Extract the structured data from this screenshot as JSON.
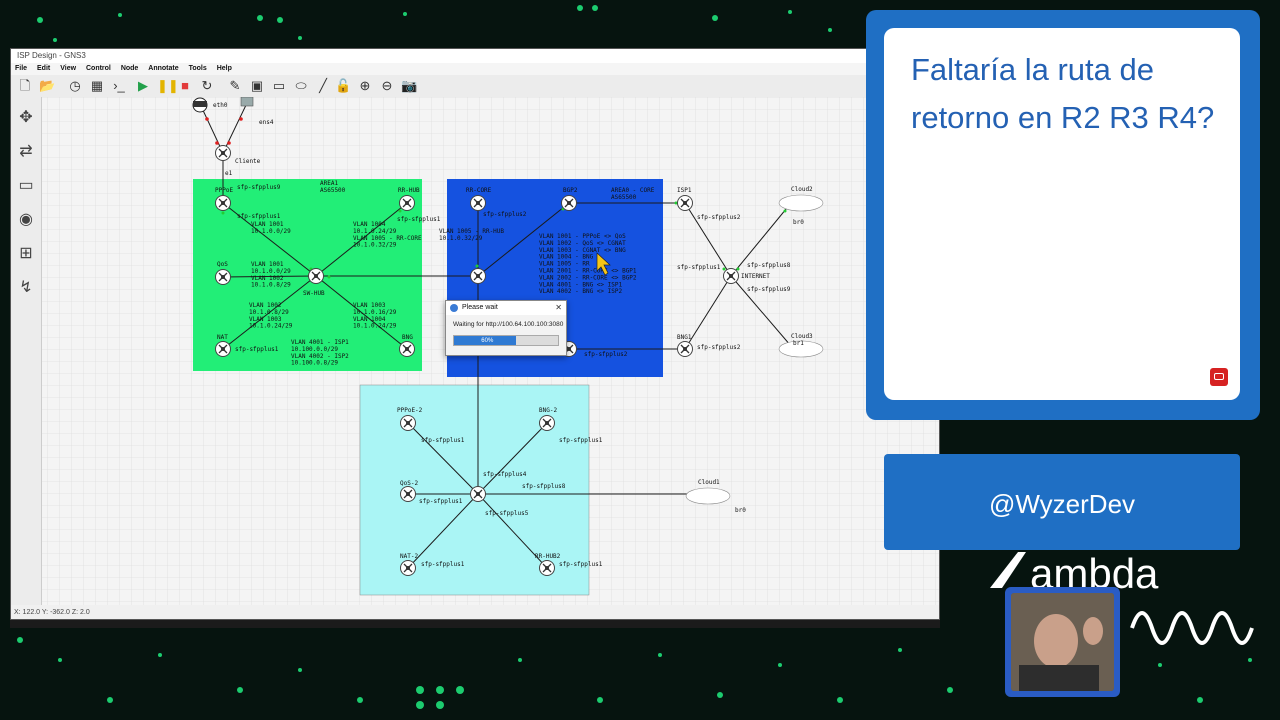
{
  "window": {
    "title": "ISP Design - GNS3",
    "menu": [
      "File",
      "Edit",
      "View",
      "Control",
      "Node",
      "Annotate",
      "Tools",
      "Help"
    ],
    "status": "X: 122.0 Y: -362.0 Z: 2.0"
  },
  "topology": {
    "area_green_label": "AREA1\nAS65500",
    "area_blue_label": "AREA0 - CORE\nAS65500",
    "nodes": {
      "eth0": "eth0",
      "ens4": "ens4",
      "cliente": "Cliente",
      "pppoe": "PPPoE",
      "rr_hub": "RR-HUB",
      "qos": "QoS",
      "sw_hub": "SW-HUB",
      "nat": "NAT",
      "bng": "BNG",
      "rr_core": "RR-CORE",
      "bgp2": "BGP2",
      "isp1": "ISP1",
      "internet": "INTERNET",
      "bng1": "BNG1",
      "cloud2": "Cloud2",
      "cloud3": "Cloud3",
      "cloud1": "Cloud1",
      "br0a": "br0",
      "br0b": "br0",
      "br1": "br1",
      "pppoe2": "PPPoE-2",
      "bng2": "BNG-2",
      "qos2": "QoS-2",
      "nat2": "NAT-2",
      "rrhub2": "RR-HUB2"
    },
    "vlan_green": [
      "VLAN 1001\n10.1.0.0/29",
      "VLAN 1004\n10.1.0.24/29\nVLAN 1005 - RR-CORE\n10.1.0.32/29",
      "VLAN 1001\n10.1.0.0/29\nVLAN 1002\n10.1.0.8/29",
      "VLAN 1002\n10.1.0.8/29\nVLAN 1003\n10.1.0.24/29",
      "VLAN 1003\n10.1.0.16/29\nVLAN 1004\n10.1.0.24/29",
      "VLAN 4001 - ISP1\n10.100.0.0/29\nVLAN 4002 - ISP2\n10.100.0.8/29"
    ],
    "vlan_blue": [
      "VLAN 1005 - RR-HUB\n10.1.0.32/29",
      "VLAN 1001 - PPPoE <> QoS\nVLAN 1002 - QoS <> CGNAT\nVLAN 1003 - CGNAT <> BNG\nVLAN 1004 - BNG\nVLAN 1005 - RR\nVLAN 2001 - RR-CORE <> BGP1\nVLAN 2002 - RR-CORE <> BGP2\nVLAN 4001 - BNG <> ISP1\nVLAN 4002 - BNG <> ISP2"
    ],
    "ports": {
      "sfp_plus1": "sfp-sfpplus1",
      "sfp_plus2": "sfp-sfpplus2",
      "sfp_plus4": "sfp-sfpplus4",
      "sfp_plus5": "sfp-sfpplus5",
      "sfp_plus8": "sfp-sfpplus8",
      "sfp_plus9": "sfp-sfpplus9",
      "e1": "e1"
    }
  },
  "dialog": {
    "title": "Please wait",
    "message": "Waiting for http://100.64.100.100:3080",
    "progress_percent": 60,
    "progress_label": "60%"
  },
  "overlay": {
    "question": "Faltaría la ruta de retorno en R2 R3 R4?",
    "handle": "@WyzerDev",
    "brand": "ambda"
  },
  "colors": {
    "accent_blue": "#1f6fc4",
    "area_green": "#22ee77",
    "area_blue": "#1552e0",
    "area_cyan": "#aaf5f5",
    "question_text": "#2461b3"
  }
}
